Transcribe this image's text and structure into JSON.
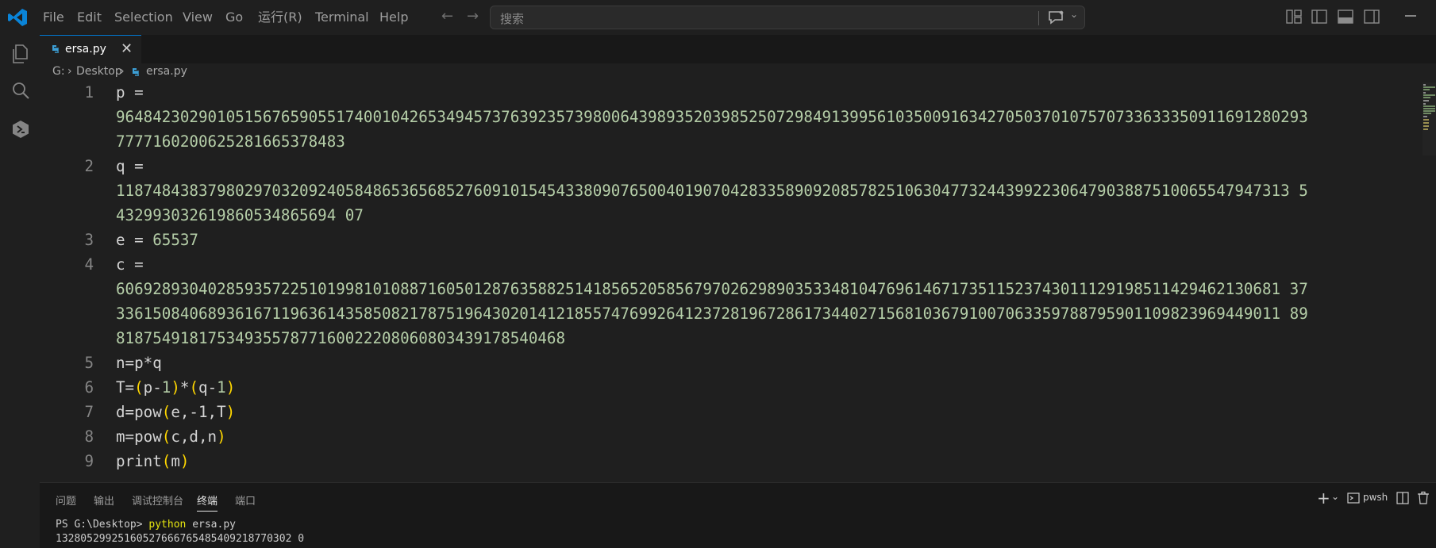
{
  "menu": [
    "File",
    "Edit",
    "Selection",
    "View",
    "Go",
    "运行(R)",
    "Terminal",
    "Help"
  ],
  "search": {
    "placeholder": "搜索"
  },
  "tab": {
    "filename": "ersa.py",
    "close_glyph": "✕"
  },
  "breadcrumb": {
    "drive": "G:",
    "folder": "Desktop",
    "file": "ersa.py"
  },
  "code": {
    "ln1": "1",
    "ln2": "2",
    "ln3": "3",
    "ln4": "4",
    "ln5": "5",
    "ln6": "6",
    "ln7": "7",
    "ln8": "8",
    "ln9": "9",
    "p_prefix": "p =",
    "p_val_1": "9648423029010515676590551740010426534945737639235739800643989352039852507298491399561035009163427050370107570733633350911691280293",
    "p_val_2": "7777160200625281665378483",
    "q_prefix": "q =",
    "q_val_1": "11874843837980297032092405848653656852760910154543380907650040190704283358909208578251063047732443992230647903887510065547947313 5",
    "q_val_2": "432993032619860534865694 07",
    "e_prefix": "e = ",
    "e_val": "65537",
    "c_prefix": "c =",
    "c_val_1": "6069289304028593572251019981010887160501287635882514185652058567970262989035334810476961467173511523743011129198511429462130681 37",
    "c_val_2": "3361508406893616711963614358508217875196430201412185574769926412372819672861734402715681036791007063359788795901109823969449011 89",
    "c_val_3": "8187549181753493557877160022208060803439178540468",
    "l5": "n=p*q",
    "l6_T": "T=",
    "l6_p": "p-",
    "l6_1a": "1",
    "l6_mul": "*",
    "l6_q": "q-",
    "l6_1b": "1",
    "l7_a": "d=pow",
    "l7_b": "e,-1,T",
    "l8_a": "m=pow",
    "l8_b": "c,d,n",
    "l9_a": "print",
    "l9_b": "m",
    "open_paren": "(",
    "close_paren": ")"
  },
  "panel": {
    "tabs": [
      "问题",
      "输出",
      "调试控制台",
      "终端",
      "端口"
    ],
    "active_tab": "终端",
    "shell": "pwsh",
    "terminal": {
      "prompt": "PS G:\\Desktop> ",
      "command": "python",
      "args": " ersa.py",
      "output": "13280529925160527666765485409218770302 0"
    }
  },
  "colors": {
    "accent": "#0078d4",
    "number": "#b5cea8",
    "bracket": "#ffd700",
    "python_icon": "#3c9fd6"
  }
}
